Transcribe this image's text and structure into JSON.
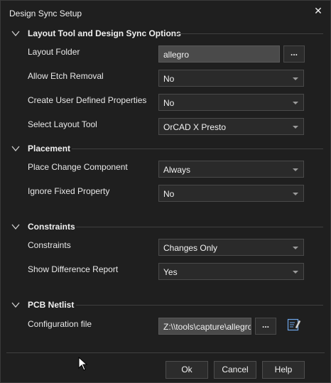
{
  "window": {
    "title": "Design Sync Setup",
    "close_glyph": "✕"
  },
  "sections": {
    "layout": {
      "title": "Layout Tool and Design Sync Options"
    },
    "placement": {
      "title": "Placement"
    },
    "constraints": {
      "title": "Constraints"
    },
    "pcb": {
      "title": "PCB Netlist"
    }
  },
  "fields": {
    "layout_folder": {
      "label": "Layout Folder",
      "value": "allegro",
      "browse": "..."
    },
    "allow_etch_removal": {
      "label": "Allow Etch Removal",
      "value": "No"
    },
    "create_user_defined": {
      "label": "Create User Defined Properties",
      "value": "No"
    },
    "select_layout_tool": {
      "label": "Select Layout Tool",
      "value": "OrCAD X Presto"
    },
    "place_change_component": {
      "label": "Place Change Component",
      "value": "Always"
    },
    "ignore_fixed_property": {
      "label": "Ignore Fixed Property",
      "value": "No"
    },
    "constraints": {
      "label": "Constraints",
      "value": "Changes Only"
    },
    "show_difference_report": {
      "label": "Show Difference Report",
      "value": "Yes"
    },
    "configuration_file": {
      "label": "Configuration file",
      "value": "Z:\\\\tools\\capture\\allegro",
      "browse": "..."
    }
  },
  "buttons": {
    "ok": "Ok",
    "cancel": "Cancel",
    "help": "Help"
  },
  "icons": {
    "chevron": "chevron-down-icon",
    "edit": "edit-file-icon",
    "cursor": "mouse-pointer-icon"
  },
  "colors": {
    "background": "#1f1f1f",
    "control": "#2a2a2a",
    "textbox": "#4a4a4a",
    "text": "#e8e8e8"
  }
}
